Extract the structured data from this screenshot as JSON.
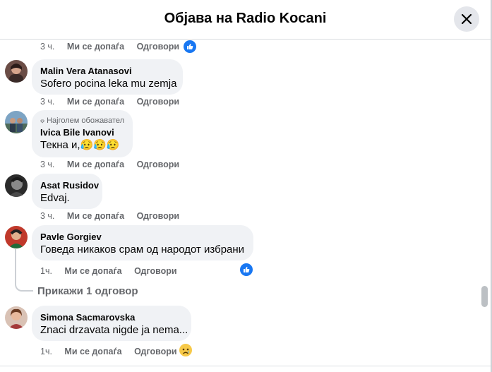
{
  "header": {
    "title": "Објава на Radio Kocani",
    "close_icon": "close-icon"
  },
  "actions": {
    "like": "Ми се допаѓа",
    "reply": "Одговори"
  },
  "comments": [
    {
      "author": "",
      "text": "",
      "time": "3 ч.",
      "reaction": "like"
    },
    {
      "author": "Malin Vera Atanasovi",
      "text": "Sofero pocina leka mu zemja",
      "time": "3 ч."
    },
    {
      "badge": "Најголем обожавател",
      "author": "Ivica Bile Ivanovi",
      "text": "Текна и,😥😥😥",
      "time": "3 ч."
    },
    {
      "author": "Asat Rusidov",
      "text": "Edvaj.",
      "time": "3 ч."
    },
    {
      "author": "Pavle Gorgiev",
      "text": "Говеда никаков срам од народот избрани",
      "time": "1ч.",
      "reaction": "like",
      "show_replies": "Прикажи 1 одговор"
    },
    {
      "author": "Simona Sacmarovska",
      "text": "Znaci drzavata nigde ja nema...",
      "time": "1ч.",
      "reaction": "sad"
    }
  ],
  "colors": {
    "like_blue": "#1877f2",
    "bubble": "#f0f2f5",
    "meta": "#65676b"
  }
}
